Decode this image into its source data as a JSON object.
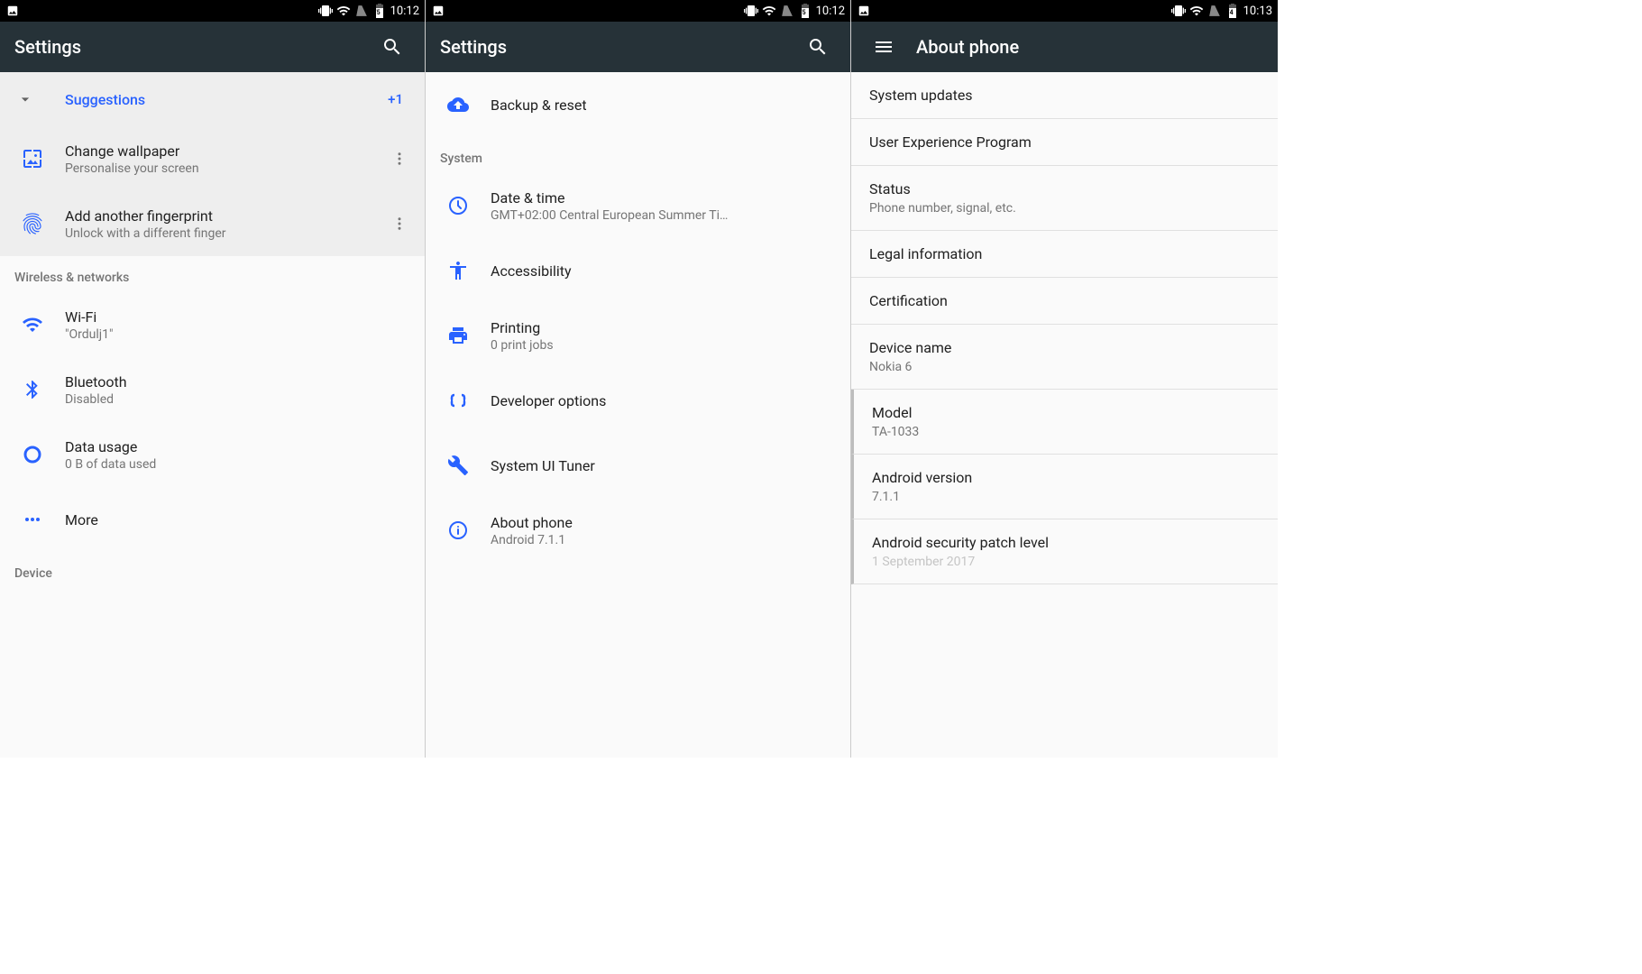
{
  "status": {
    "time1": "10:12",
    "time2": "10:12",
    "time3": "10:13",
    "battery12": "75",
    "battery3": "74"
  },
  "pane1": {
    "title": "Settings",
    "suggestions": {
      "label": "Suggestions",
      "count": "+1",
      "items": [
        {
          "title": "Change wallpaper",
          "sub": "Personalise your screen"
        },
        {
          "title": "Add another fingerprint",
          "sub": "Unlock with a different finger"
        }
      ]
    },
    "section_wireless": "Wireless & networks",
    "wifi": {
      "title": "Wi-Fi",
      "sub": "\"Ordulj1\""
    },
    "bluetooth": {
      "title": "Bluetooth",
      "sub": "Disabled"
    },
    "data_usage": {
      "title": "Data usage",
      "sub": "0 B of data used"
    },
    "more": {
      "title": "More"
    },
    "section_device": "Device"
  },
  "pane2": {
    "title": "Settings",
    "backup": {
      "title": "Backup & reset"
    },
    "section_system": "System",
    "date_time": {
      "title": "Date & time",
      "sub": "GMT+02:00 Central European Summer Ti…"
    },
    "accessibility": {
      "title": "Accessibility"
    },
    "printing": {
      "title": "Printing",
      "sub": "0 print jobs"
    },
    "developer": {
      "title": "Developer options"
    },
    "tuner": {
      "title": "System UI Tuner"
    },
    "about": {
      "title": "About phone",
      "sub": "Android 7.1.1"
    }
  },
  "pane3": {
    "title": "About phone",
    "items": [
      {
        "title": "System updates",
        "sub": ""
      },
      {
        "title": "User Experience Program",
        "sub": ""
      },
      {
        "title": "Status",
        "sub": "Phone number, signal, etc."
      },
      {
        "title": "Legal information",
        "sub": ""
      },
      {
        "title": "Certification",
        "sub": ""
      },
      {
        "title": "Device name",
        "sub": "Nokia 6"
      },
      {
        "title": "Model",
        "sub": "TA-1033"
      },
      {
        "title": "Android version",
        "sub": "7.1.1"
      },
      {
        "title": "Android security patch level",
        "sub": "1 September 2017"
      }
    ]
  }
}
